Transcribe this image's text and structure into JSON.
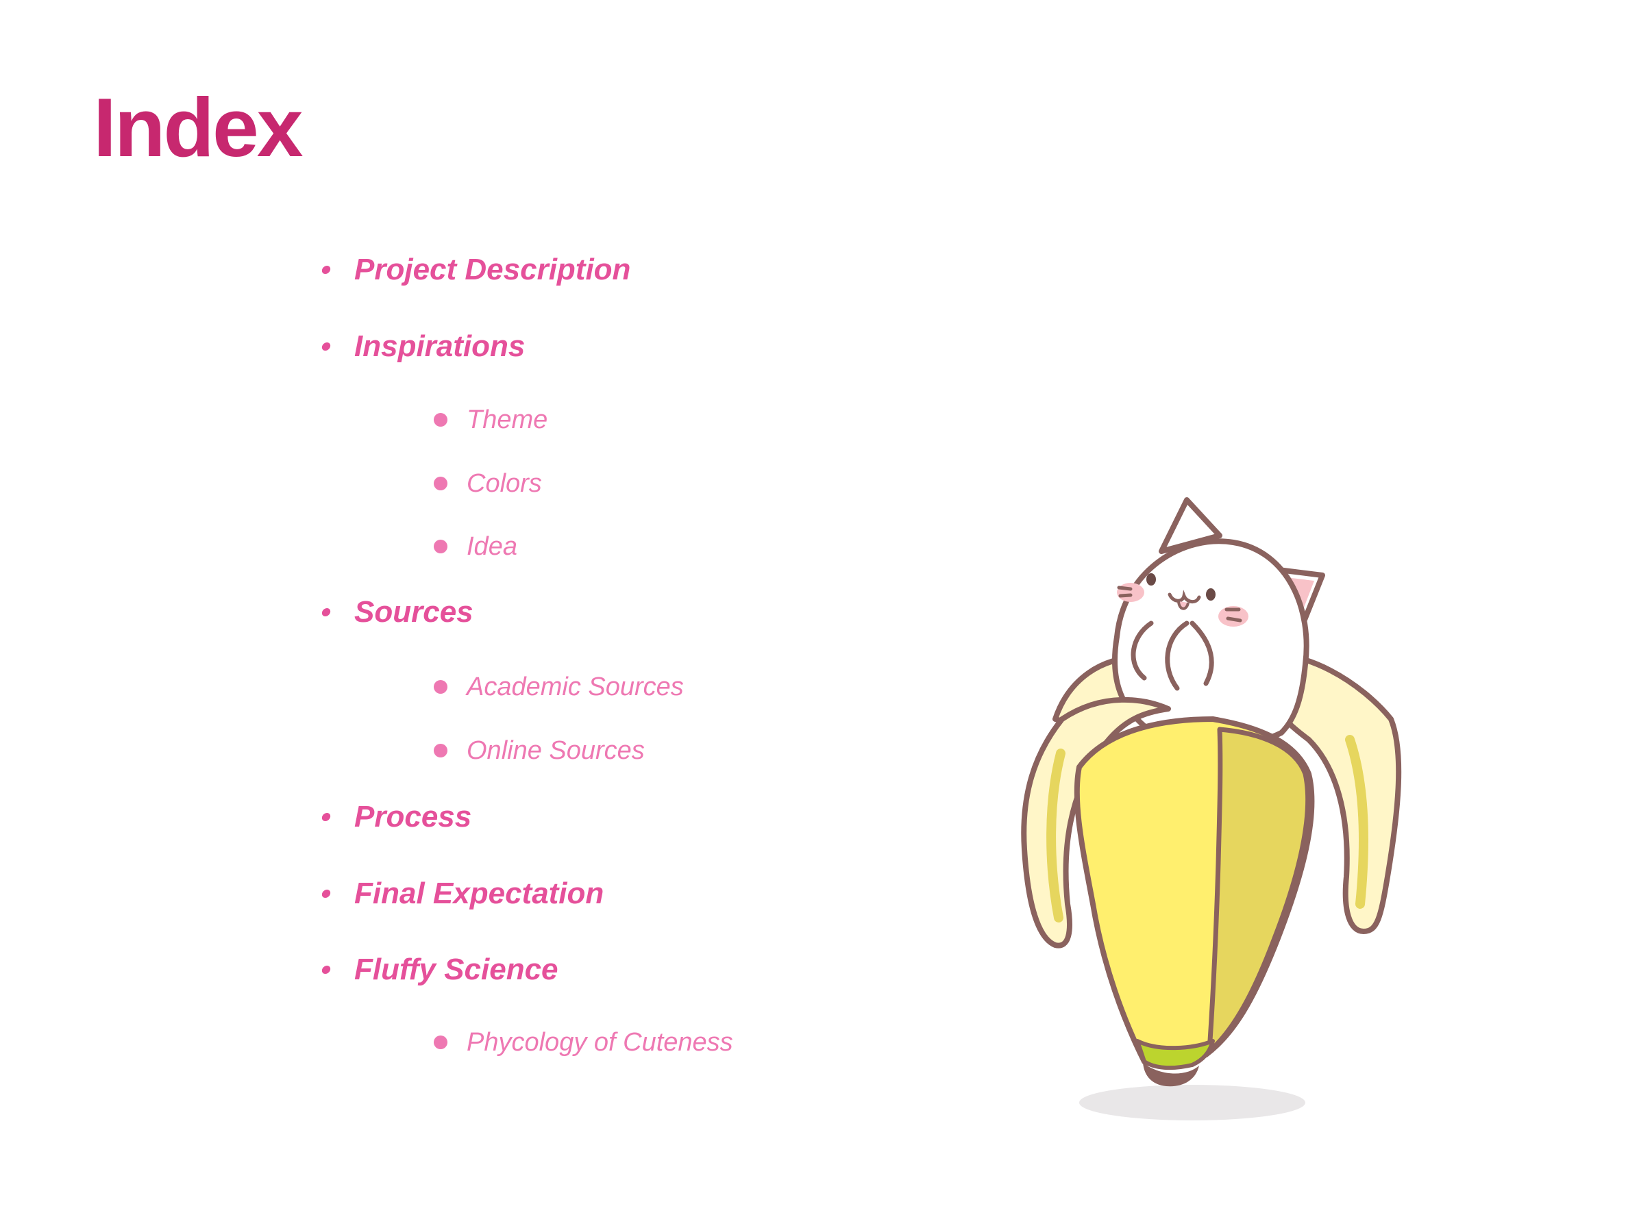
{
  "slide": {
    "title": "Index",
    "colors": {
      "title": "#C7286F",
      "level1": "#E5509A",
      "level2": "#EE78B2",
      "banana_peel_inner": "#FFF6C8",
      "banana_fruit": "#FFEF6E",
      "banana_shadow": "#E6D65E",
      "banana_tip": "#BCD42E",
      "outline": "#8A625E",
      "blush": "#F8C2C8",
      "ground_shadow": "#E9E7E8"
    },
    "items": [
      {
        "level": 1,
        "label": "Project Description"
      },
      {
        "level": 1,
        "label": "Inspirations"
      },
      {
        "level": 2,
        "label": "Theme"
      },
      {
        "level": 2,
        "label": "Colors"
      },
      {
        "level": 2,
        "label": "Idea"
      },
      {
        "level": 1,
        "label": "Sources"
      },
      {
        "level": 2,
        "label": "Academic Sources"
      },
      {
        "level": 2,
        "label": "Online Sources"
      },
      {
        "level": 1,
        "label": "Process"
      },
      {
        "level": 1,
        "label": "Final Expectation"
      },
      {
        "level": 1,
        "label": "Fluffy Science"
      },
      {
        "level": 2,
        "label": "Phycology of Cuteness"
      }
    ],
    "illustration": {
      "icon": "cat-in-banana-icon"
    }
  }
}
